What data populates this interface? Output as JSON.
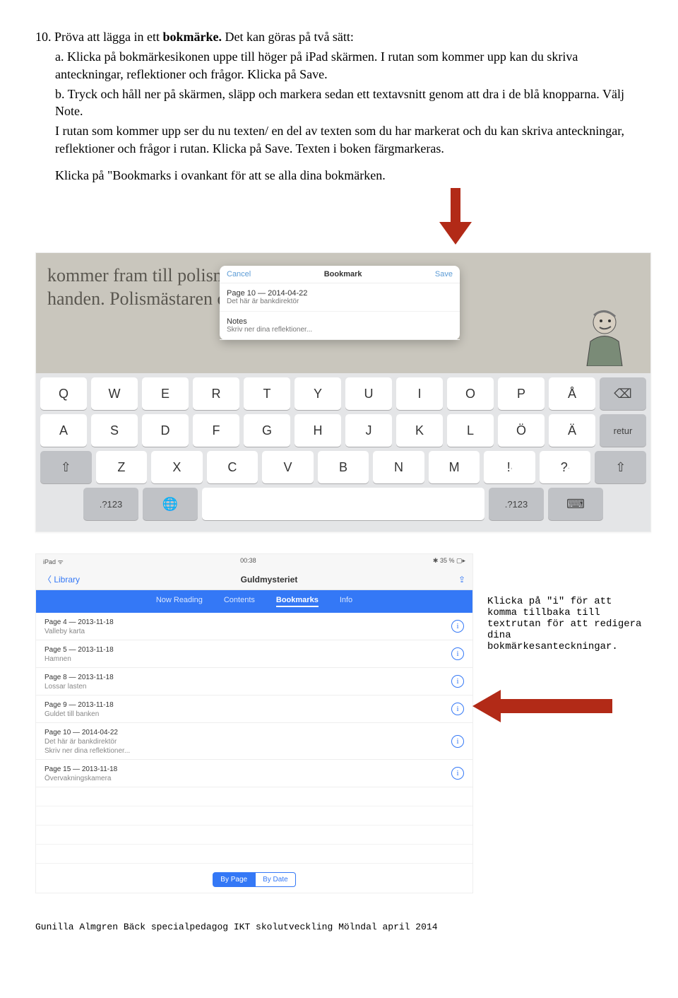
{
  "doc": {
    "line1_prefix": "10. Pröva att lägga in ett ",
    "line1_bold": "bokmärke.",
    "line1_suffix": " Det kan göras på två sätt:",
    "a_label": "a.",
    "a_text": " Klicka på bokmärkesikonen uppe till höger på iPad skärmen. I rutan som kommer upp kan du skriva anteckningar, reflektioner och frågor. Klicka på Save.",
    "b_label": "b.",
    "b_text": " Tryck och håll ner på skärmen, släpp och markera sedan ett textavsnitt genom att dra i de blå knopparna. Välj Note.",
    "b_cont1": "I rutan som kommer upp ser du nu texten/ en del av texten som du har markerat och du kan skriva anteckningar, reflektioner och frågor i rutan. Klicka på Save. Texten i boken färgmarkeras.",
    "last": "Klicka på \"Bookmarks i ovankant för att se alla dina bokmärken."
  },
  "shot1": {
    "bg_line1": "kommer fram till polismästaren och sträcker fram",
    "bg_line2": "handen. Polismästaren o",
    "popup": {
      "cancel": "Cancel",
      "title": "Bookmark",
      "save": "Save",
      "page": "Page 10 — 2014-04-22",
      "subtitle": "Det här är bankdirektör",
      "notes_label": "Notes",
      "notes_placeholder": "Skriv ner dina reflektioner..."
    },
    "keys": {
      "row1": [
        "Q",
        "W",
        "E",
        "R",
        "T",
        "Y",
        "U",
        "I",
        "O",
        "P",
        "Å"
      ],
      "row1_back": "⌫",
      "row2": [
        "A",
        "S",
        "D",
        "F",
        "G",
        "H",
        "J",
        "K",
        "L",
        "Ö",
        "Ä"
      ],
      "row2_return": "retur",
      "row3_shift": "⇧",
      "row3": [
        "Z",
        "X",
        "C",
        "V",
        "B",
        "N",
        "M"
      ],
      "row3_punct1": "!",
      "row3_punct1_sub": ",",
      "row3_punct2": "?",
      "row3_punct2_sub": ".",
      "row3_shift2": "⇧",
      "row4_num": ".?123",
      "row4_globe": "🌐",
      "row4_num2": ".?123",
      "row4_hide": "⌨"
    }
  },
  "shot2": {
    "status": {
      "left": "iPad ᯤ",
      "center": "00:38",
      "right": "✱ 35 % ▢▸"
    },
    "nav": {
      "back": "〈 Library",
      "title": "Guldmysteriet",
      "share": "⇪"
    },
    "tabs": {
      "t1": "Now Reading",
      "t2": "Contents",
      "t3": "Bookmarks",
      "t4": "Info"
    },
    "rows": [
      {
        "date": "Page 4 — 2013-11-18",
        "sub": "Valleby karta"
      },
      {
        "date": "Page 5 — 2013-11-18",
        "sub": "Hamnen"
      },
      {
        "date": "Page 8 — 2013-11-18",
        "sub": "Lossar lasten"
      },
      {
        "date": "Page 9 — 2013-11-18",
        "sub": "Guldet till banken"
      },
      {
        "date": "Page 10 — 2014-04-22",
        "sub": "Det här är bankdirektör",
        "sub2": "Skriv ner dina reflektioner..."
      },
      {
        "date": "Page 15 — 2013-11-18",
        "sub": "Övervakningskamera"
      }
    ],
    "seg": {
      "bypage": "By Page",
      "bydate": "By Date"
    }
  },
  "side_note": "Klicka på \"i\" för att komma tillbaka till textrutan för att redigera dina bokmärkesanteckningar.",
  "footer": "Gunilla Almgren Bäck   specialpedagog  IKT skolutveckling   Mölndal april 2014",
  "colors": {
    "arrow": "#b22a17"
  }
}
